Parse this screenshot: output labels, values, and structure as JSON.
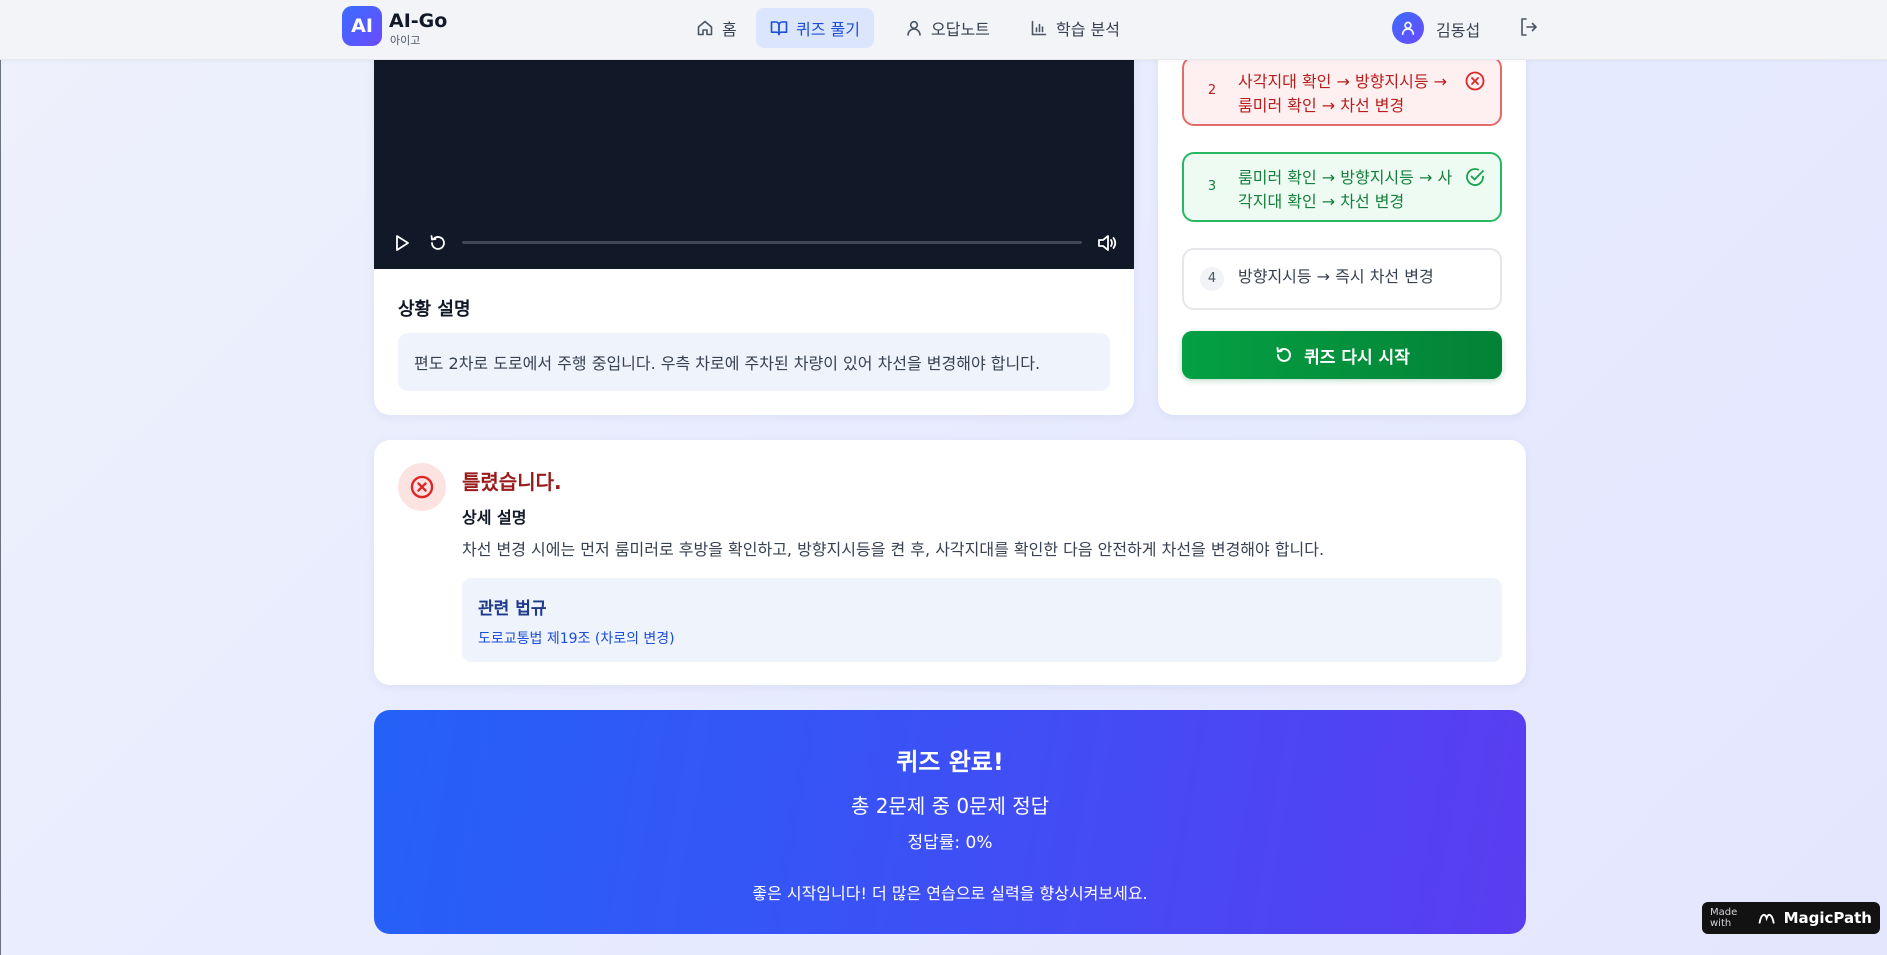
{
  "header": {
    "logo_mark": "AI",
    "app_name": "AI-Go",
    "app_subtitle": "아이고",
    "nav": [
      {
        "label": "홈",
        "icon": "home-icon"
      },
      {
        "label": "퀴즈 풀기",
        "icon": "book-open-icon",
        "active": true
      },
      {
        "label": "오답노트",
        "icon": "user-icon"
      },
      {
        "label": "학습 분석",
        "icon": "bar-chart-icon"
      }
    ],
    "user_name": "김동섭"
  },
  "video": {
    "situation_title": "상황 설명",
    "situation_text": "편도 2차로 도로에서 주행 중입니다. 우측 차로에 주차된 차량이 있어 차선을 변경해야 합니다.",
    "progress": 0
  },
  "options": [
    {
      "number": "2",
      "text": "사각지대 확인 → 방향지시등 → 룸미러 확인 → 차선 변경",
      "state": "wrong"
    },
    {
      "number": "3",
      "text": "룸미러 확인 → 방향지시등 → 사각지대 확인 → 차선 변경",
      "state": "correct"
    },
    {
      "number": "4",
      "text": "방향지시등 → 즉시 차선 변경",
      "state": "neutral"
    }
  ],
  "restart_label": "퀴즈 다시 시작",
  "result": {
    "title": "틀렸습니다.",
    "detail_title": "상세 설명",
    "detail_text": "차선 변경 시에는 먼저 룸미러로 후방을 확인하고, 방향지시등을 켠 후, 사각지대를 확인한 다음 안전하게 차선을 변경해야 합니다.",
    "law_title": "관련 법규",
    "law_text": "도로교통법 제19조 (차로의 변경)"
  },
  "complete": {
    "title": "퀴즈 완료!",
    "score": "총 2문제 중 0문제 정답",
    "rate": "정답률: 0%",
    "message": "좋은 시작입니다! 더 많은 연습으로 실력을 향상시켜보세요."
  },
  "badge": {
    "small": "Made with",
    "brand": "MagicPath"
  },
  "colors": {
    "accent": "#2563eb",
    "wrong": "#dc2626",
    "correct": "#16a34a",
    "restart": "#04a043"
  }
}
